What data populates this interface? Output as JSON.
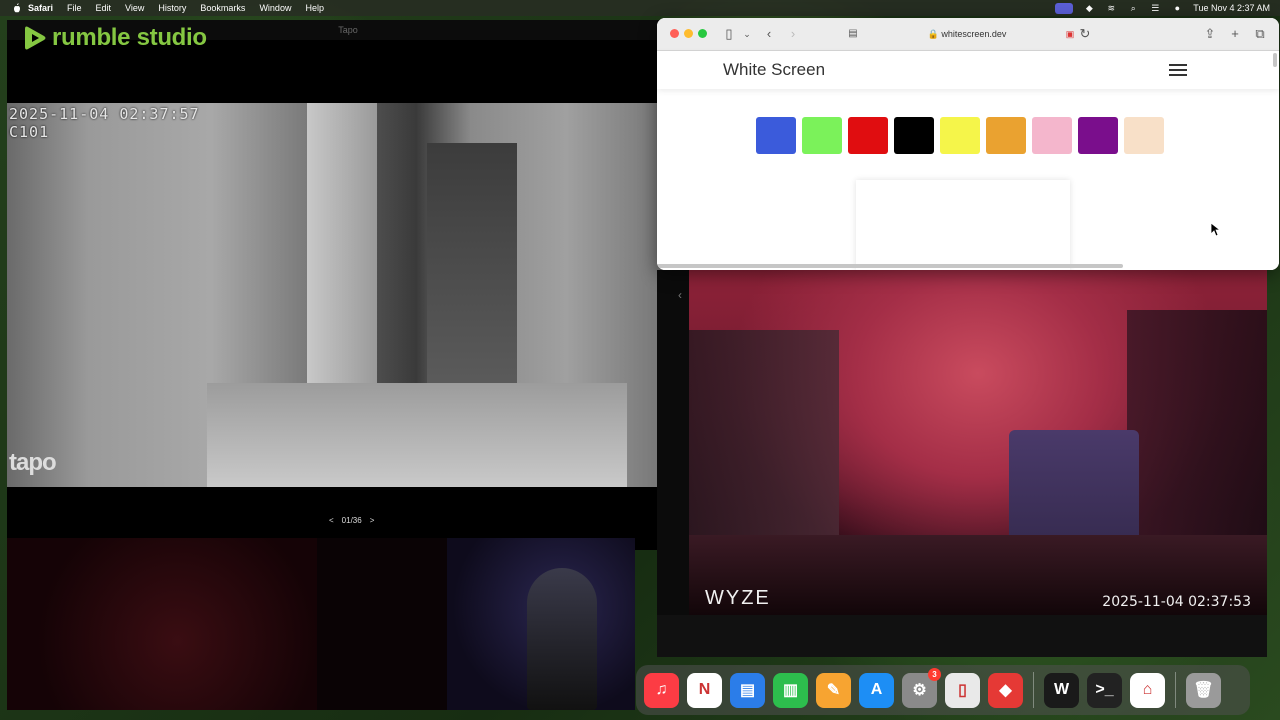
{
  "menubar": {
    "app": "Safari",
    "items": [
      "File",
      "Edit",
      "View",
      "History",
      "Bookmarks",
      "Window",
      "Help"
    ],
    "clock": "Tue Nov 4  2:37 AM"
  },
  "tapo": {
    "title": "Tapo",
    "brand": "rumble studio",
    "timestamp": "2025-11-04 02:37:57",
    "camera_id": "C101",
    "watermark": "tapo",
    "pager": {
      "prev": "<",
      "label": "01/36",
      "next": ">"
    }
  },
  "safari": {
    "url": "whitescreen.dev",
    "page_title": "White Screen",
    "swatches": [
      "#3b5bdb",
      "#7bf25a",
      "#e00d10",
      "#000000",
      "#f5f54a",
      "#eaa230",
      "#f4b6cc",
      "#7a0e8c",
      "#f8e0c8"
    ]
  },
  "wyze": {
    "logo": "WYZE",
    "timestamp": "2025-11-04  02:37:53"
  },
  "dock": {
    "apps": [
      {
        "name": "music",
        "color": "#fc3c44",
        "glyph": "♫"
      },
      {
        "name": "news",
        "color": "#ffffff",
        "glyph": "N"
      },
      {
        "name": "keynote",
        "color": "#2b7de9",
        "glyph": "▤"
      },
      {
        "name": "numbers",
        "color": "#2dbe4d",
        "glyph": "▥"
      },
      {
        "name": "pages",
        "color": "#f7a431",
        "glyph": "✎"
      },
      {
        "name": "app-store",
        "color": "#1d8ef5",
        "glyph": "A"
      },
      {
        "name": "system-settings",
        "color": "#8a8a8a",
        "glyph": "⚙",
        "badge": "3"
      },
      {
        "name": "pdf-tool",
        "color": "#e9e9e9",
        "glyph": "▯"
      },
      {
        "name": "anydesk",
        "color": "#e53935",
        "glyph": "◆"
      },
      {
        "name": "wyze-app",
        "color": "#1a1a1a",
        "glyph": "W"
      },
      {
        "name": "terminal",
        "color": "#222222",
        "glyph": ">_"
      },
      {
        "name": "home",
        "color": "#ffffff",
        "glyph": "⌂"
      },
      {
        "name": "trash",
        "color": "#9a9a9a",
        "glyph": "🗑"
      }
    ]
  }
}
